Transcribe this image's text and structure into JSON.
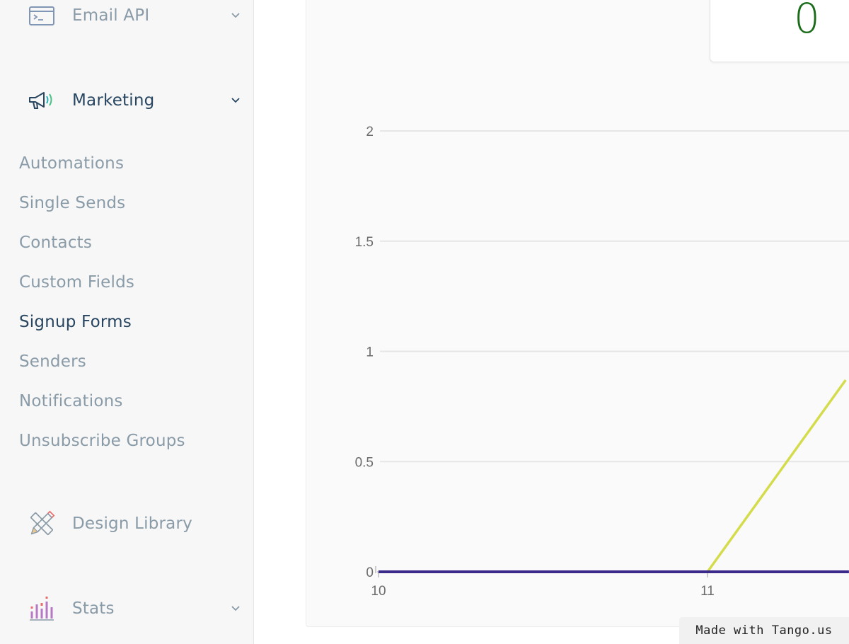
{
  "sidebar": {
    "sections": [
      {
        "id": "email-api",
        "label": "Email API",
        "icon": "terminal-window-icon",
        "expanded": false
      },
      {
        "id": "marketing",
        "label": "Marketing",
        "icon": "megaphone-icon",
        "expanded": true
      },
      {
        "id": "design-library",
        "label": "Design Library",
        "icon": "pencil-ruler-icon"
      },
      {
        "id": "stats",
        "label": "Stats",
        "icon": "bar-chart-icon",
        "expanded": false
      }
    ],
    "marketing_items": [
      {
        "label": "Automations"
      },
      {
        "label": "Single Sends"
      },
      {
        "label": "Contacts"
      },
      {
        "label": "Custom Fields"
      },
      {
        "label": "Signup Forms",
        "current": true
      },
      {
        "label": "Senders"
      },
      {
        "label": "Notifications"
      },
      {
        "label": "Unsubscribe Groups"
      }
    ]
  },
  "stat_card": {
    "value": "0"
  },
  "chart_data": {
    "type": "line",
    "x_ticks": [
      "10",
      "11"
    ],
    "y_ticks": [
      "0",
      "0.5",
      "1",
      "1.5",
      "2"
    ],
    "ylim": [
      0,
      2
    ],
    "grid": true,
    "series": [
      {
        "color": "#d4dc4c",
        "points": [
          {
            "x": 10,
            "y": 0
          },
          {
            "x": 11,
            "y": 0
          },
          {
            "x": 11.42,
            "y": 0.87
          }
        ]
      },
      {
        "color": "#3c2a8a",
        "points": [
          {
            "x": 10,
            "y": 0
          },
          {
            "x": 11.43,
            "y": 0
          }
        ]
      }
    ]
  },
  "watermark": "Made with Tango.us",
  "colors": {
    "sidebar_bg": "#f7f7f7",
    "muted_text": "#8a9ba8",
    "active_text": "#294661",
    "stat_green": "#1a6b1a"
  }
}
